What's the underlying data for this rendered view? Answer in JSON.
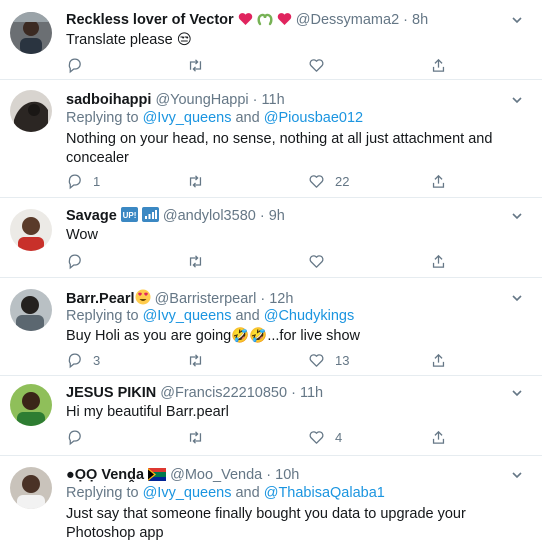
{
  "colors": {
    "text": "#14171a",
    "secondary": "#657786",
    "link": "#1b95e0",
    "divider": "#e6ecf0",
    "heart_red": "#e0245e",
    "green_heart": "#77b255"
  },
  "tweets": [
    {
      "name": "Reckless lover of Vector",
      "handle": "@Dessymama2",
      "dot": "·",
      "time": "8h",
      "reply_prefix": "",
      "reply_to_1": "",
      "reply_and": "",
      "reply_to_2": "",
      "text": "Translate please 😒",
      "replies": "",
      "retweets": "",
      "likes": ""
    },
    {
      "name": "sadboihappi",
      "handle": "@YoungHappi",
      "dot": "·",
      "time": "11h",
      "reply_prefix": "Replying to ",
      "reply_to_1": "@Ivy_queens",
      "reply_and": " and ",
      "reply_to_2": "@Piousbae012",
      "text": "Nothing on your head, no sense, nothing at all just attachment and concealer",
      "replies": "1",
      "retweets": "",
      "likes": "22"
    },
    {
      "name": "Savage",
      "handle": "@andylol3580",
      "dot": "·",
      "time": "9h",
      "reply_prefix": "",
      "reply_to_1": "",
      "reply_and": "",
      "reply_to_2": "",
      "text": "Wow",
      "replies": "",
      "retweets": "",
      "likes": ""
    },
    {
      "name": "Barr.Pearl",
      "handle": "@Barristerpearl",
      "dot": "·",
      "time": "12h",
      "reply_prefix": "Replying to ",
      "reply_to_1": "@Ivy_queens",
      "reply_and": " and ",
      "reply_to_2": "@Chudykings",
      "text": "Buy Holi as you are going🤣🤣...for live show",
      "replies": "3",
      "retweets": "",
      "likes": "13"
    },
    {
      "name": "JESUS PIKIN",
      "handle": "@Francis22210850",
      "dot": "·",
      "time": "11h",
      "reply_prefix": "",
      "reply_to_1": "",
      "reply_and": "",
      "reply_to_2": "",
      "text": "Hi my beautiful Barr.pearl",
      "replies": "",
      "retweets": "",
      "likes": "4"
    },
    {
      "name": "●ỌỌ Venḓa",
      "handle": "@Moo_Venda",
      "dot": "·",
      "time": "10h",
      "reply_prefix": "Replying to ",
      "reply_to_1": "@Ivy_queens",
      "reply_and": " and ",
      "reply_to_2": "@ThabisaQalaba1",
      "text": "Just say that someone finally bought you data to upgrade your Photoshop app",
      "replies": "",
      "retweets": "",
      "likes": ""
    }
  ]
}
